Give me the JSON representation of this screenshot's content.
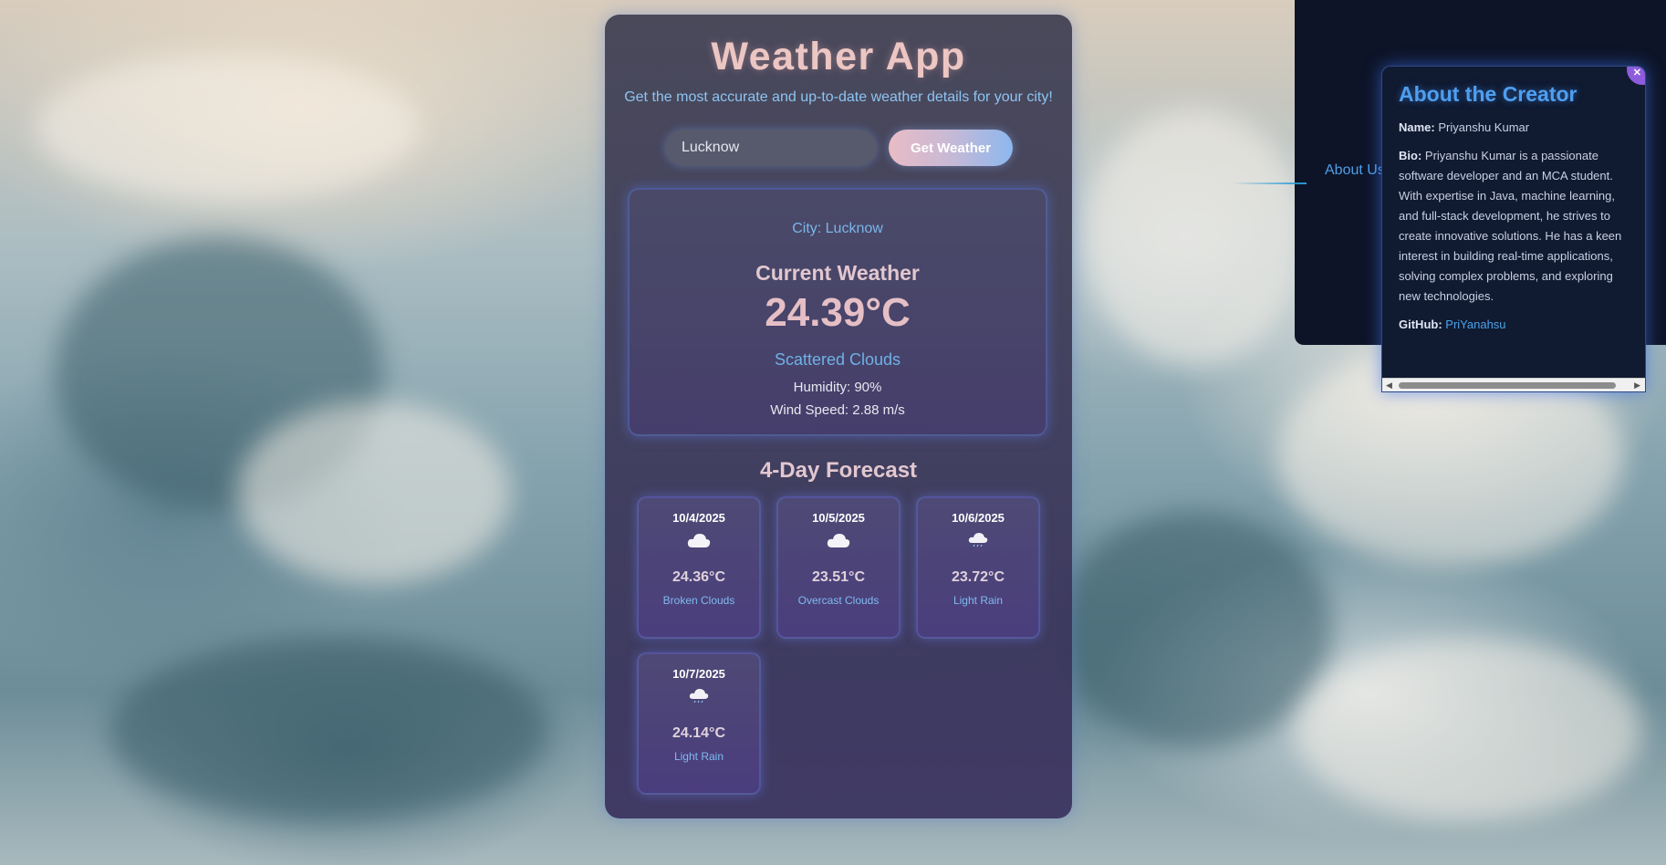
{
  "app": {
    "title": "Weather App",
    "subtitle": "Get the most accurate and up-to-date weather details for your city!"
  },
  "search": {
    "value": "Lucknow",
    "button_label": "Get Weather"
  },
  "current": {
    "city": "City: Lucknow",
    "heading": "Current Weather",
    "temperature": "24.39°C",
    "description": "Scattered Clouds",
    "humidity": "Humidity: 90%",
    "wind": "Wind Speed: 2.88 m/s"
  },
  "forecast": {
    "heading": "4-Day Forecast",
    "days": [
      {
        "date": "10/4/2025",
        "icon": "cloud-icon",
        "temp": "24.36°C",
        "desc": "Broken Clouds"
      },
      {
        "date": "10/5/2025",
        "icon": "cloud-icon",
        "temp": "23.51°C",
        "desc": "Overcast Clouds"
      },
      {
        "date": "10/6/2025",
        "icon": "cloud-rain-icon",
        "temp": "23.72°C",
        "desc": "Light Rain"
      },
      {
        "date": "10/7/2025",
        "icon": "cloud-rain-icon",
        "temp": "24.14°C",
        "desc": "Light Rain"
      }
    ]
  },
  "about": {
    "link_label": "About Us",
    "panel_title": "About the Creator",
    "name_label": "Name:",
    "name": "Priyanshu Kumar",
    "bio_label": "Bio:",
    "bio": "Priyanshu Kumar is a passionate software developer and an MCA student. With expertise in Java, machine learning, and full-stack development, he strives to create innovative solutions. He has a keen interest in building real-time applications, solving complex problems, and exploring new technologies.",
    "github_label": "GitHub:",
    "github": "PriYanahsu"
  },
  "colors": {
    "accent_blue": "#4e9ff0",
    "title_pink": "#ecc6c3",
    "card_purple": "#3a3260"
  }
}
